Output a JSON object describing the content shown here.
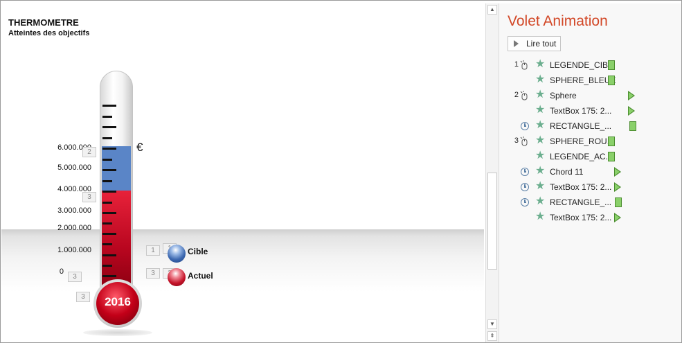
{
  "slide": {
    "title": "THERMOMETRE",
    "subtitle": "Atteintes des objectifs",
    "scale_labels": [
      "6.000.000",
      "5.000.000",
      "4.000.000",
      "3.000.000",
      "2.000.000",
      "1.000.000",
      "0"
    ],
    "currency": "€",
    "year": "2016",
    "legend": {
      "target": "Cible",
      "actual": "Actuel"
    },
    "markers": {
      "m_scale6": "2",
      "m_scale4": "3",
      "m_zero": "3",
      "m_bulb": "3",
      "cible_a": "1",
      "cible_b": "1",
      "actuel_a": "3",
      "actuel_b": "3"
    },
    "colors": {
      "target": "#5a85c7",
      "actual": "#c5142a"
    }
  },
  "scrollbar": {
    "up": "▲",
    "down": "▼",
    "more": "⇞"
  },
  "pane": {
    "title": "Volet Animation",
    "play_all": "Lire tout",
    "items": [
      {
        "num": "1",
        "trigger": "mouse-icon",
        "label": "LEGENDE_CIB...",
        "timing": "bar"
      },
      {
        "num": "",
        "trigger": "",
        "label": "SPHERE_BLEUE",
        "timing": "bar"
      },
      {
        "num": "2",
        "trigger": "mouse-icon",
        "label": "Sphere",
        "timing": "triangle"
      },
      {
        "num": "",
        "trigger": "",
        "label": "TextBox 175: 2...",
        "timing": "triangle"
      },
      {
        "num": "",
        "trigger": "clock-icon",
        "label": "RECTANGLE_...",
        "timing": "bar"
      },
      {
        "num": "3",
        "trigger": "mouse-icon",
        "label": "SPHERE_ROU...",
        "timing": "bar"
      },
      {
        "num": "",
        "trigger": "",
        "label": "LEGENDE_AC...",
        "timing": "bar"
      },
      {
        "num": "",
        "trigger": "clock-icon",
        "label": "Chord 11",
        "timing": "triangle"
      },
      {
        "num": "",
        "trigger": "clock-icon",
        "label": "TextBox 175: 2...",
        "timing": "triangle"
      },
      {
        "num": "",
        "trigger": "clock-icon",
        "label": "RECTANGLE_...",
        "timing": "bar"
      },
      {
        "num": "",
        "trigger": "",
        "label": "TextBox 175: 2...",
        "timing": "triangle"
      }
    ]
  }
}
